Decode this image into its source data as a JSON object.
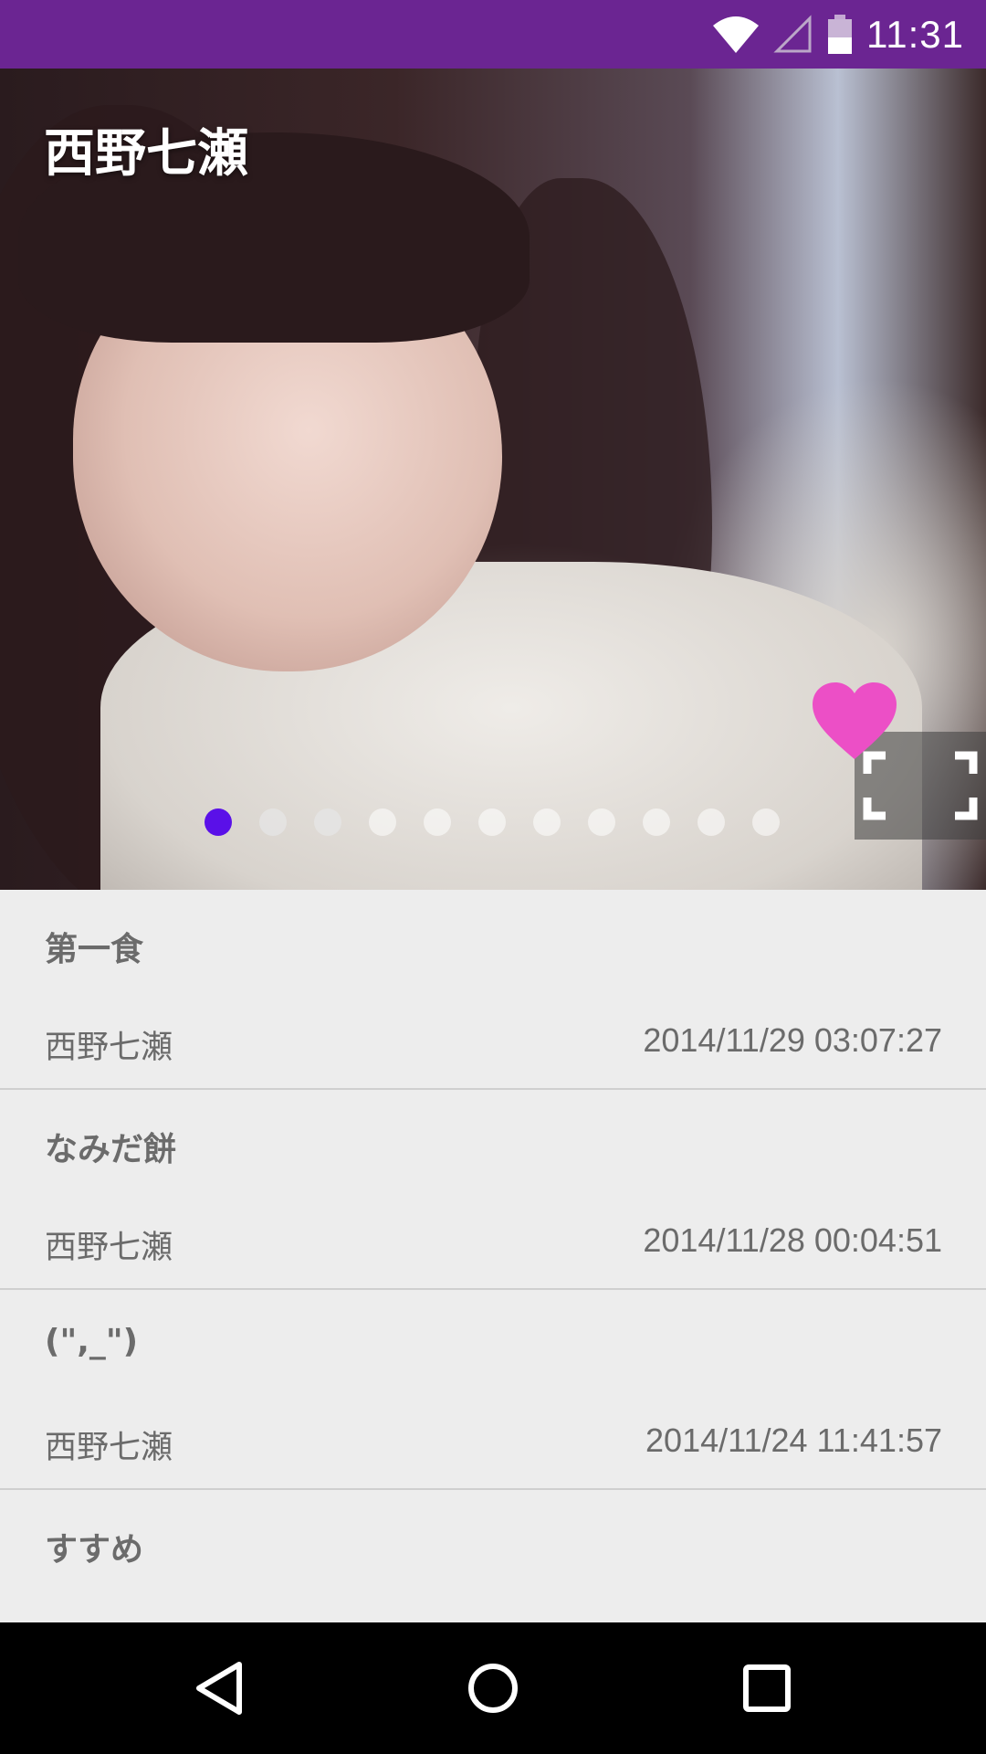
{
  "status_bar": {
    "time": "11:31",
    "icons": [
      "wifi-icon",
      "cell-signal-icon",
      "battery-icon"
    ],
    "background": "#6b2592"
  },
  "hero": {
    "title": "西野七瀬",
    "carousel": {
      "total": 11,
      "active_index": 0,
      "active_color": "#5a10e8"
    },
    "favorite_icon": "heart-icon",
    "favorite_color": "#ec4fc6",
    "fullscreen_icon": "fullscreen-icon"
  },
  "posts": [
    {
      "title": "第一食",
      "author": "西野七瀬",
      "date": "2014/11/29 03:07:27"
    },
    {
      "title": "なみだ餅",
      "author": "西野七瀬",
      "date": "2014/11/28 00:04:51"
    },
    {
      "title": "(\",_\")",
      "author": "西野七瀬",
      "date": "2014/11/24 11:41:57"
    },
    {
      "title": "すすめ",
      "author": "",
      "date": ""
    }
  ],
  "nav_bar": {
    "buttons": [
      "back-icon",
      "home-icon",
      "recents-icon"
    ]
  }
}
